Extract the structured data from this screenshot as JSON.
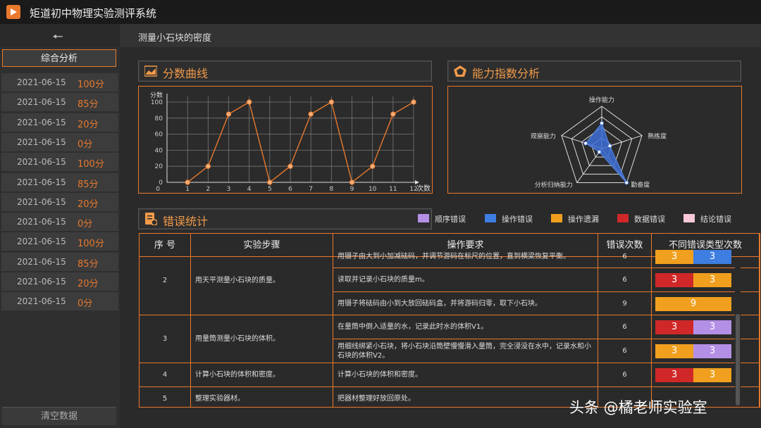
{
  "app": {
    "title": "矩道初中物理实验测评系统"
  },
  "page": {
    "title": "测量小石块的密度"
  },
  "sidebar": {
    "summary_label": "综合分析",
    "clear_label": "清空数据",
    "records": [
      {
        "date": "2021-06-15",
        "score": "100分"
      },
      {
        "date": "2021-06-15",
        "score": "85分"
      },
      {
        "date": "2021-06-15",
        "score": "20分"
      },
      {
        "date": "2021-06-15",
        "score": "0分"
      },
      {
        "date": "2021-06-15",
        "score": "100分"
      },
      {
        "date": "2021-06-15",
        "score": "85分"
      },
      {
        "date": "2021-06-15",
        "score": "20分"
      },
      {
        "date": "2021-06-15",
        "score": "0分"
      },
      {
        "date": "2021-06-15",
        "score": "100分"
      },
      {
        "date": "2021-06-15",
        "score": "85分"
      },
      {
        "date": "2021-06-15",
        "score": "20分"
      },
      {
        "date": "2021-06-15",
        "score": "0分"
      }
    ]
  },
  "panels": {
    "score_curve": "分数曲线",
    "ability": "能力指数分析",
    "errors": "错误统计"
  },
  "chart_data": [
    {
      "type": "line",
      "ylabel": "分数",
      "xlabel": "次数",
      "x": [
        1,
        2,
        3,
        4,
        5,
        6,
        7,
        8,
        9,
        10,
        11,
        12
      ],
      "values": [
        0,
        20,
        85,
        100,
        0,
        20,
        85,
        100,
        0,
        20,
        85,
        100
      ],
      "ylim": [
        0,
        100
      ],
      "yticks": [
        0,
        20,
        40,
        60,
        80,
        100
      ],
      "grid": true,
      "color": "#e8792d"
    },
    {
      "type": "radar",
      "axes": [
        "操作能力",
        "熟练度",
        "勤奋度",
        "分析归纳能力",
        "观察能力"
      ],
      "values": [
        0.6,
        0.2,
        1.0,
        0.1,
        0.4
      ],
      "range": [
        0,
        1
      ],
      "color": "#3d6fd6"
    }
  ],
  "legend": [
    {
      "label": "顺序错误",
      "color": "#b48fe6"
    },
    {
      "label": "操作错误",
      "color": "#3d7ee0"
    },
    {
      "label": "操作遗漏",
      "color": "#f0a01e"
    },
    {
      "label": "数据错误",
      "color": "#d02828"
    },
    {
      "label": "结论错误",
      "color": "#f8c8d8"
    }
  ],
  "table": {
    "headers": [
      "序 号",
      "实验步骤",
      "操作要求",
      "错误次数",
      "不同错误类型次数"
    ],
    "rows": [
      {
        "no": "2",
        "step": "用天平测量小石块的质量。",
        "req": "用镊子由大到小加减砝码，并调节游码在标尺的位置，直到横梁恢复平衡。",
        "count": "6",
        "segs": [
          {
            "v": "3",
            "c": "#f0a01e"
          },
          {
            "v": "3",
            "c": "#3d7ee0"
          }
        ]
      },
      {
        "no": "",
        "step": "",
        "req": "读取并记录小石块的质量m。",
        "count": "6",
        "segs": [
          {
            "v": "3",
            "c": "#d02828"
          },
          {
            "v": "3",
            "c": "#f0a01e"
          }
        ]
      },
      {
        "no": "",
        "step": "",
        "req": "用镊子将砝码由小到大放回砝码盒，并将游码归零，取下小石块。",
        "count": "9",
        "segs": [
          {
            "v": "9",
            "c": "#f0a01e"
          }
        ]
      },
      {
        "no": "3",
        "step": "用量筒测量小石块的体积。",
        "req": "在量筒中倒入适量的水，记录此时水的体积V1。",
        "count": "6",
        "segs": [
          {
            "v": "3",
            "c": "#d02828"
          },
          {
            "v": "3",
            "c": "#b48fe6"
          }
        ]
      },
      {
        "no": "",
        "step": "",
        "req": "用细线绑紧小石块，将小石块沿筒壁慢慢滑入量筒，完全浸没在水中，记录水和小石块的体积V2。",
        "count": "6",
        "segs": [
          {
            "v": "3",
            "c": "#f0a01e"
          },
          {
            "v": "3",
            "c": "#b48fe6"
          }
        ]
      },
      {
        "no": "4",
        "step": "计算小石块的体积和密度。",
        "req": "计算小石块的体积和密度。",
        "count": "6",
        "segs": [
          {
            "v": "3",
            "c": "#d02828"
          },
          {
            "v": "3",
            "c": "#f0a01e"
          }
        ]
      },
      {
        "no": "5",
        "step": "整理实验器材。",
        "req": "把器材整理好放回原处。",
        "count": "",
        "segs": []
      }
    ]
  },
  "watermark": "头条 @橘老师实验室"
}
